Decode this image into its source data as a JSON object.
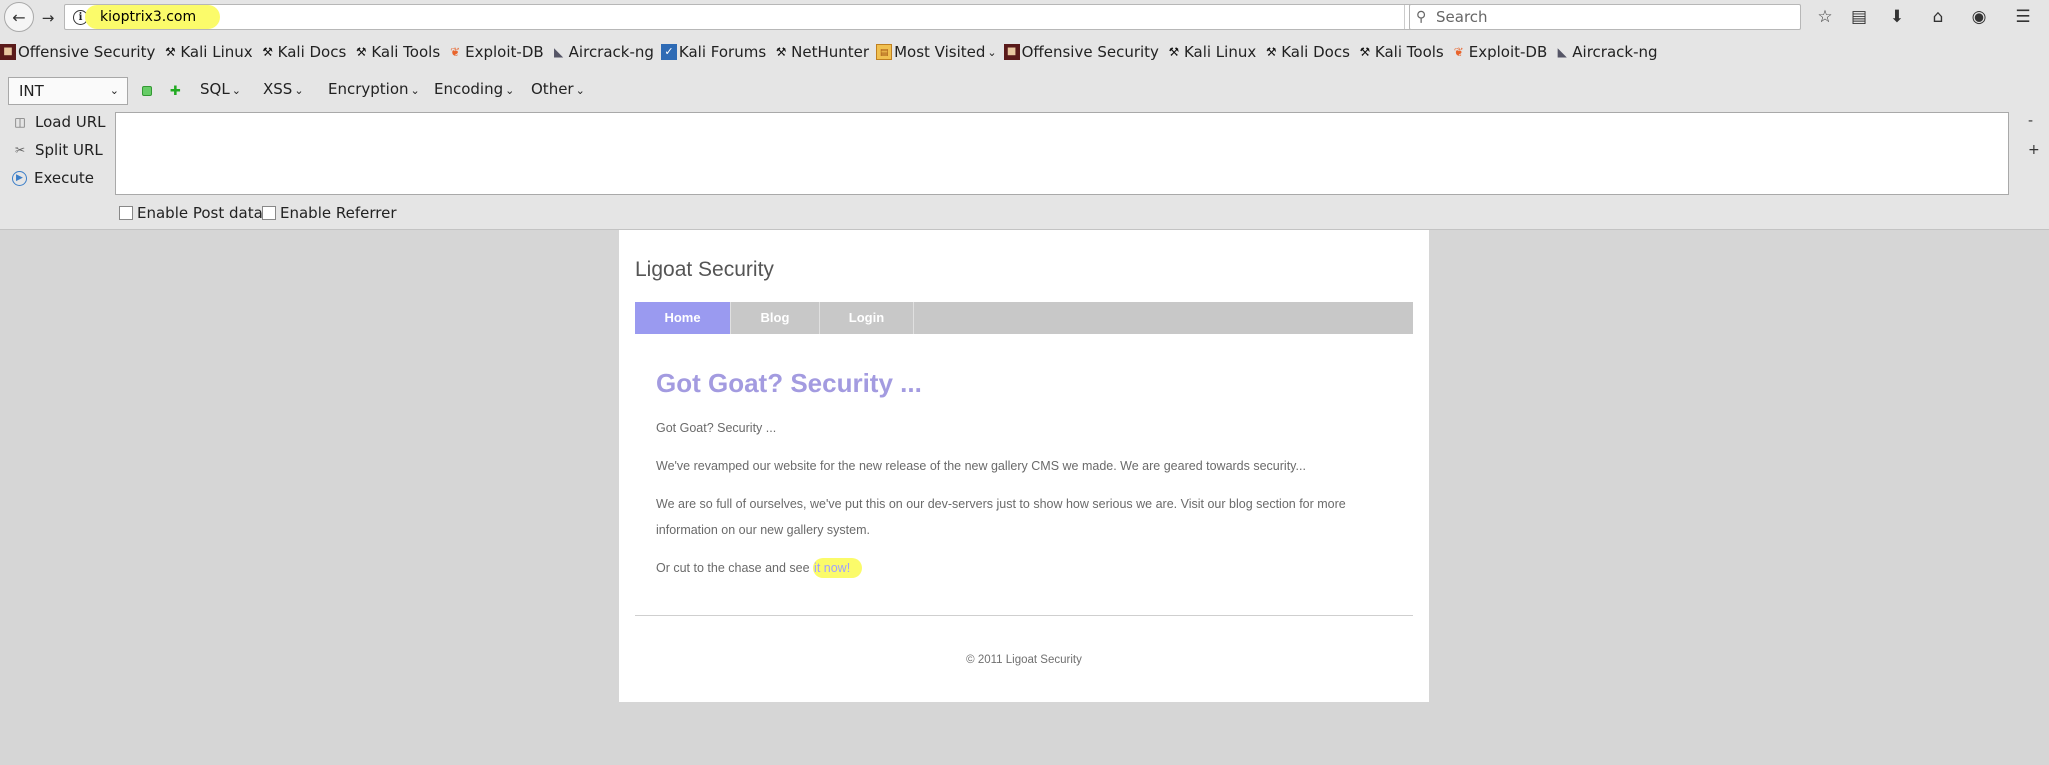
{
  "browser": {
    "url": "kioptrix3.com",
    "search_placeholder": "Search",
    "bookmarks": [
      {
        "label": "Offensive Security",
        "icon": "offsec-icon"
      },
      {
        "label": "Kali Linux",
        "icon": "kali-icon"
      },
      {
        "label": "Kali Docs",
        "icon": "kali-icon"
      },
      {
        "label": "Kali Tools",
        "icon": "kali-icon"
      },
      {
        "label": "Exploit-DB",
        "icon": "exploitdb-icon"
      },
      {
        "label": "Aircrack-ng",
        "icon": "aircrack-icon"
      },
      {
        "label": "Kali Forums",
        "icon": "kali-forums-icon"
      },
      {
        "label": "NetHunter",
        "icon": "kali-icon"
      },
      {
        "label": "Most Visited",
        "icon": "most-visited-icon"
      },
      {
        "label": "Offensive Security",
        "icon": "offsec-icon"
      },
      {
        "label": "Kali Linux",
        "icon": "kali-icon"
      },
      {
        "label": "Kali Docs",
        "icon": "kali-icon"
      },
      {
        "label": "Kali Tools",
        "icon": "kali-icon"
      },
      {
        "label": "Exploit-DB",
        "icon": "exploitdb-icon"
      },
      {
        "label": "Aircrack-ng",
        "icon": "aircrack-icon"
      }
    ]
  },
  "hackbar": {
    "select_value": "INT",
    "menus": [
      "SQL",
      "XSS",
      "Encryption",
      "Encoding",
      "Other"
    ],
    "actions": {
      "load_url": "Load URL",
      "split_url": "Split URL",
      "execute": "Execute"
    },
    "side_minus": "-",
    "side_plus": "+",
    "enable_post": "Enable Post data",
    "enable_referrer": "Enable Referrer"
  },
  "site": {
    "title": "Ligoat Security",
    "nav": [
      "Home",
      "Blog",
      "Login"
    ],
    "heading": "Got Goat? Security ...",
    "p1": "Got Goat? Security ...",
    "p2": "We've revamped our website for the new release of the new gallery CMS we made. We are geared towards security...",
    "p3": "We are so full of ourselves, we've put this on our dev-servers just to show how serious we are. Visit our blog section for more information on our new gallery system.",
    "p4_prefix": "Or cut to the chase and see ",
    "p4_link": "it now!",
    "footer": "© 2011 Ligoat Security"
  },
  "colors": {
    "accent_nav": "#9a9af0",
    "heading": "#a39be0",
    "highlight": "#fbfb6a"
  }
}
